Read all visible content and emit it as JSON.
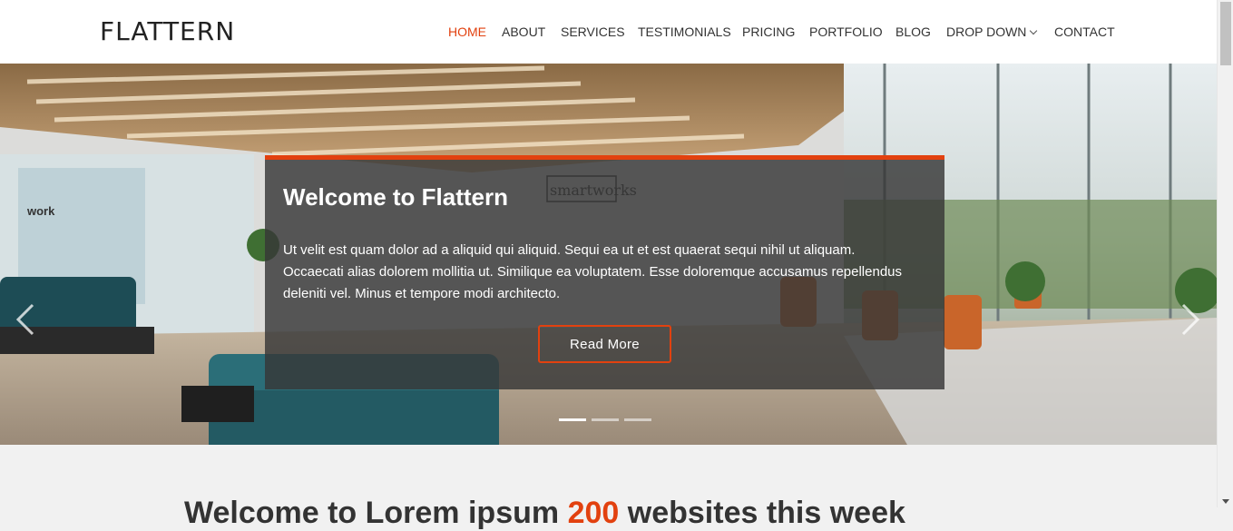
{
  "brand": {
    "logo": "FLATTERN",
    "accent": "#e2410f"
  },
  "nav": {
    "items": [
      {
        "label": "HOME",
        "active": true
      },
      {
        "label": "ABOUT"
      },
      {
        "label": "SERVICES"
      },
      {
        "label": "TESTIMONIALS"
      },
      {
        "label": "PRICING"
      },
      {
        "label": "PORTFOLIO"
      },
      {
        "label": "BLOG"
      },
      {
        "label": "DROP DOWN"
      },
      {
        "label": "CONTACT"
      }
    ]
  },
  "hero": {
    "title": "Welcome to Flattern",
    "text": "Ut velit est quam dolor ad a aliquid qui aliquid. Sequi ea ut et est quaerat sequi nihil ut aliquam. Occaecati alias dolorem mollitia ut. Similique ea voluptatem. Esse doloremque accusamus repellendus deleniti vel. Minus et tempore modi architecto.",
    "button": "Read More",
    "slides": 3,
    "active_slide": 1,
    "bg_sign": "smartworks",
    "wall_text": "work"
  },
  "section": {
    "title_start": "Welcome to Lorem ipsum",
    "title_highlight": "200",
    "title_end": "websites this week"
  }
}
